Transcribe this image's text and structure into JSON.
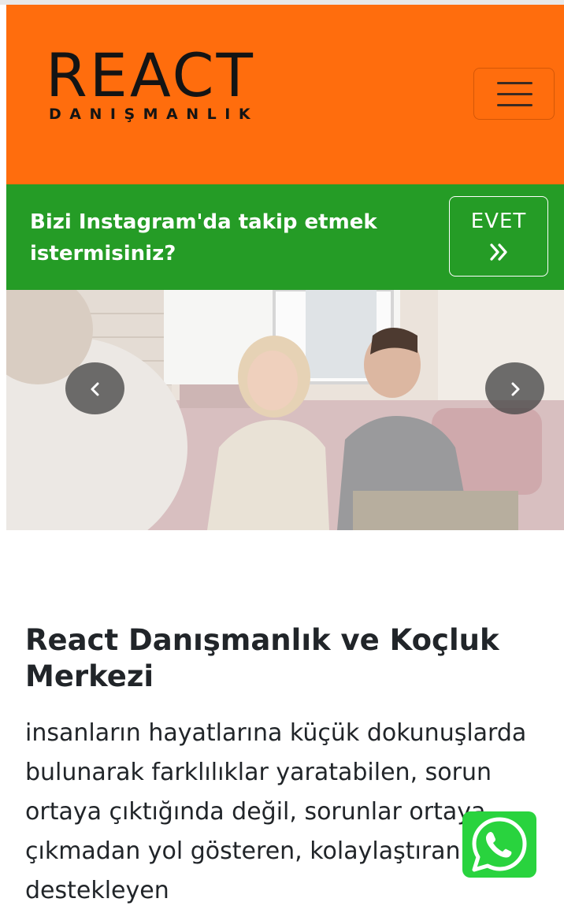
{
  "header": {
    "logo_main": "REACT",
    "logo_sub": "DANIŞMANLIK"
  },
  "instagram_banner": {
    "text": "Bizi Instagram'da takip etmek istermisiniz?",
    "button_label": "EVET"
  },
  "hero": {
    "image_alt": "Counseling session photo"
  },
  "main": {
    "title": "React Danışmanlık ve Koçluk Merkezi",
    "description": "insanların hayatlarına küçük dokunuşlarda bulunarak farklılıklar yaratabilen, sorun ortaya çıktığında değil, sorunlar ortaya çıkmadan yol gösteren, kolaylaştıran ve destekleyen"
  },
  "colors": {
    "header_bg": "#ff6d0d",
    "banner_bg": "#259c26",
    "whatsapp": "#29d33e",
    "text": "#212529"
  },
  "icons": {
    "menu": "hamburger-icon",
    "evet": "double-chevron-right-icon",
    "prev": "chevron-left-icon",
    "next": "chevron-right-icon",
    "whatsapp": "whatsapp-icon"
  }
}
